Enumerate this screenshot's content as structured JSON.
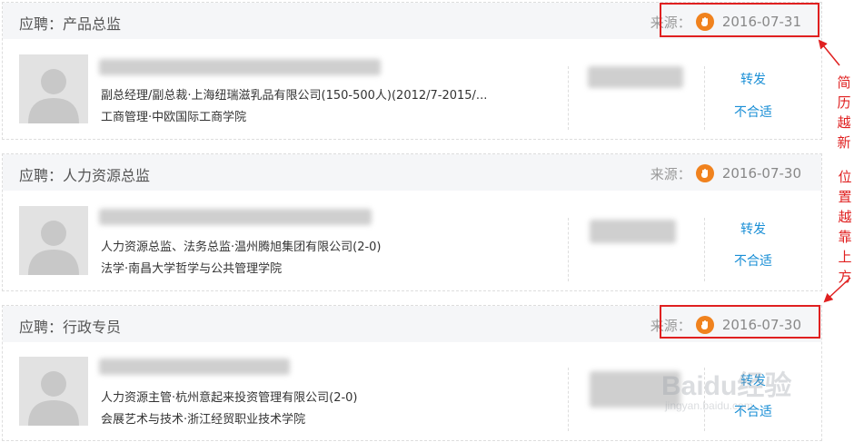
{
  "source_label": "来源：",
  "candidates": [
    {
      "job": "应聘：产品总监",
      "date": "2016-07-31",
      "experience": "副总经理/副总裁·上海纽瑞滋乳品有限公司(150-500人)(2012/7-2015/...",
      "education": "工商管理·中欧国际工商学院",
      "forward": "转发",
      "reject": "不合适"
    },
    {
      "job": "应聘：人力资源总监",
      "date": "2016-07-30",
      "experience": "人力资源总监、法务总监·温州腾旭集团有限公司(2-0)",
      "education": "法学·南昌大学哲学与公共管理学院",
      "forward": "转发",
      "reject": "不合适"
    },
    {
      "job": "应聘：行政专员",
      "date": "2016-07-30",
      "experience": "人力资源主管·杭州意起来投资管理有限公司(2-0)",
      "education": "会展艺术与技术·浙江经贸职业技术学院",
      "forward": "转发",
      "reject": "不合适"
    }
  ],
  "annotations": {
    "note1": [
      "简",
      "历",
      "越",
      "新"
    ],
    "note2": [
      "位",
      "置",
      "越",
      "靠",
      "上",
      "方"
    ],
    "color": "#e02020"
  },
  "watermark": {
    "main": "Baidu经验",
    "sub": "jingyan.baidu.com"
  },
  "colors": {
    "accent_link": "#1a8fd6",
    "source_icon": "#f0821e",
    "header_bg": "#f5f6f8"
  }
}
